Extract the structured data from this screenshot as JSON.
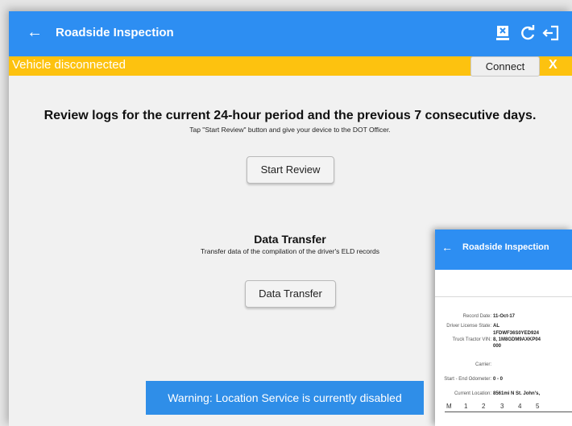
{
  "appbar": {
    "back_icon": "←",
    "title": "Roadside Inspection",
    "icons": [
      "export-icon",
      "refresh-icon",
      "logout-icon"
    ]
  },
  "banner": {
    "message": "Vehicle disconnected",
    "connect_label": "Connect",
    "close_label": "X",
    "color": "#fdc20f"
  },
  "review": {
    "title": "Review logs for the current 24-hour period and the previous 7 consecutive days.",
    "subtitle": "Tap \"Start Review\" button and give your device to the DOT Officer.",
    "button_label": "Start Review"
  },
  "data_transfer": {
    "title": "Data Transfer",
    "subtitle": "Transfer data of the compilation of the driver's ELD records",
    "button_label": "Data Transfer"
  },
  "toast": {
    "message": "Warning: Location Service is currently disabled"
  },
  "overlay": {
    "back_icon": "←",
    "title": "Roadside Inspection",
    "rows": [
      {
        "label": "Record Date:",
        "value": "11-Oct-17"
      },
      {
        "label": "Driver License State:",
        "value": "AL"
      },
      {
        "label": "Truck Tractor VIN:",
        "value_lines": [
          "1FDWF36S0YED924",
          "8, 1M8GDM9AXKP04",
          "000"
        ]
      },
      {
        "label": "Carrier:",
        "value": ""
      },
      {
        "label": "Start - End Odometer:",
        "value": "0 - 0"
      },
      {
        "label": "Current Location:",
        "value": "8561mi N St. John's,"
      }
    ],
    "axis_labels": [
      "M",
      "1",
      "2",
      "3",
      "4",
      "5"
    ]
  },
  "colors": {
    "accent": "#2d8ef2",
    "warning": "#fdc20f",
    "toast": "#2f8ee8"
  }
}
